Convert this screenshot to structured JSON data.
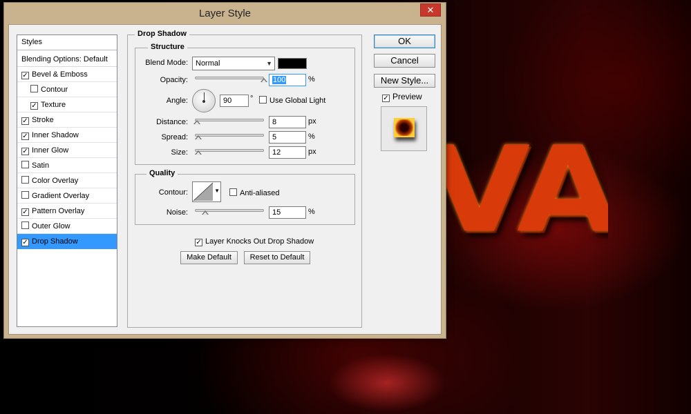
{
  "window": {
    "title": "Layer Style",
    "close_glyph": "✕"
  },
  "canvas": {
    "artwork_text": "VA"
  },
  "styles_panel": {
    "header": "Styles",
    "blending_options": "Blending Options: Default",
    "items": [
      {
        "label": "Bevel & Emboss",
        "checked": true,
        "sub": false,
        "selected": false
      },
      {
        "label": "Contour",
        "checked": false,
        "sub": true,
        "selected": false
      },
      {
        "label": "Texture",
        "checked": true,
        "sub": true,
        "selected": false
      },
      {
        "label": "Stroke",
        "checked": true,
        "sub": false,
        "selected": false
      },
      {
        "label": "Inner Shadow",
        "checked": true,
        "sub": false,
        "selected": false
      },
      {
        "label": "Inner Glow",
        "checked": true,
        "sub": false,
        "selected": false
      },
      {
        "label": "Satin",
        "checked": false,
        "sub": false,
        "selected": false
      },
      {
        "label": "Color Overlay",
        "checked": false,
        "sub": false,
        "selected": false
      },
      {
        "label": "Gradient Overlay",
        "checked": false,
        "sub": false,
        "selected": false
      },
      {
        "label": "Pattern Overlay",
        "checked": true,
        "sub": false,
        "selected": false
      },
      {
        "label": "Outer Glow",
        "checked": false,
        "sub": false,
        "selected": false
      },
      {
        "label": "Drop Shadow",
        "checked": true,
        "sub": false,
        "selected": true
      }
    ]
  },
  "drop_shadow": {
    "title": "Drop Shadow",
    "structure": {
      "title": "Structure",
      "blend_mode_label": "Blend Mode:",
      "blend_mode_value": "Normal",
      "shadow_color": "#000000",
      "opacity_label": "Opacity:",
      "opacity_value": "100",
      "opacity_unit": "%",
      "opacity_fraction": 1.0,
      "angle_label": "Angle:",
      "angle_value": "90",
      "angle_unit": "°",
      "use_global_light_label": "Use Global Light",
      "use_global_light_checked": false,
      "distance_label": "Distance:",
      "distance_value": "8",
      "distance_unit": "px",
      "distance_fraction": 0.03,
      "spread_label": "Spread:",
      "spread_value": "5",
      "spread_unit": "%",
      "spread_fraction": 0.05,
      "size_label": "Size:",
      "size_value": "12",
      "size_unit": "px",
      "size_fraction": 0.05
    },
    "quality": {
      "title": "Quality",
      "contour_label": "Contour:",
      "anti_aliased_label": "Anti-aliased",
      "anti_aliased_checked": false,
      "noise_label": "Noise:",
      "noise_value": "15",
      "noise_unit": "%",
      "noise_fraction": 0.15
    },
    "layer_knocks_out_label": "Layer Knocks Out Drop Shadow",
    "layer_knocks_out_checked": true,
    "make_default_label": "Make Default",
    "reset_default_label": "Reset to Default"
  },
  "actions": {
    "ok_label": "OK",
    "cancel_label": "Cancel",
    "new_style_label": "New Style...",
    "preview_label": "Preview",
    "preview_checked": true
  },
  "icons": {
    "check": "✓",
    "dropdown": "▼"
  }
}
